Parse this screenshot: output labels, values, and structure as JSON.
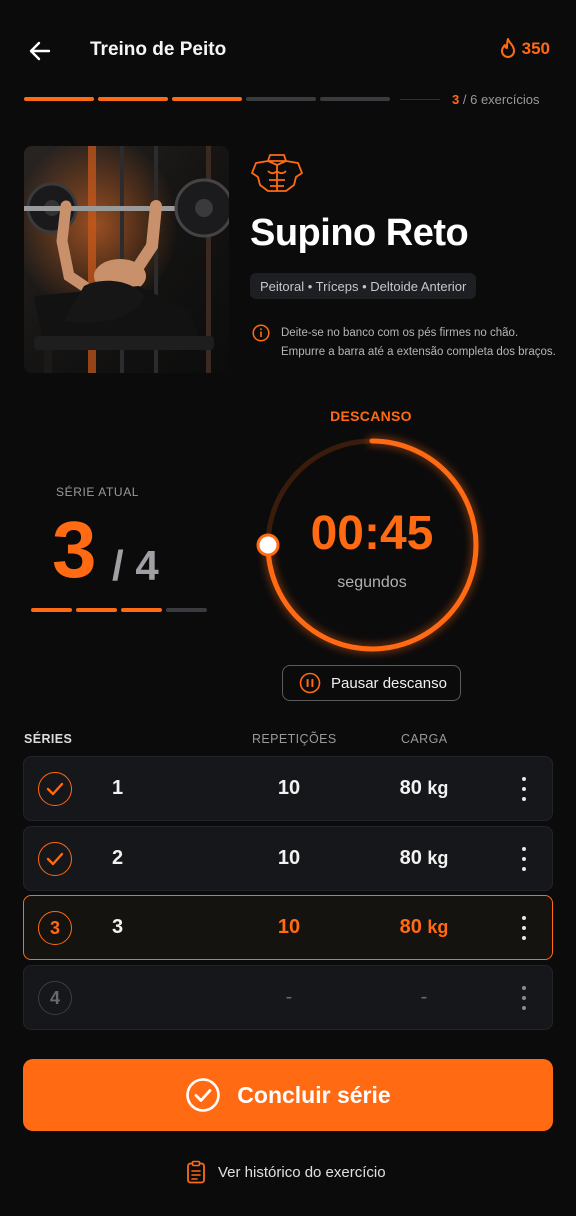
{
  "header": {
    "title": "Treino de Peito",
    "calories": "350"
  },
  "progress": {
    "current": "3",
    "separator": "/",
    "total_label": "6 exercícios",
    "completed_fraction": 0.5
  },
  "exercise": {
    "name": "Supino Reto",
    "muscles": "Peitoral • Tríceps • Deltoide Anterior",
    "instructions_line1": "Deite-se no banco com os pés firmes no chão.",
    "instructions_line2": "Empurre a barra até a extensão completa dos braços."
  },
  "current_set": {
    "label": "SÉRIE ATUAL",
    "number": "3",
    "total": "/ 4",
    "completed": 3,
    "of": 4
  },
  "rest_timer": {
    "label": "DESCANSO",
    "time": "00:45",
    "unit": "segundos",
    "remaining_fraction": 0.75,
    "pause_label": "Pausar descanso"
  },
  "sets_table": {
    "headers": {
      "series": "SÉRIES",
      "reps": "REPETIÇÕES",
      "load": "CARGA"
    },
    "rows": [
      {
        "index": "1",
        "reps": "10",
        "load": "80",
        "unit": "kg",
        "state": "done"
      },
      {
        "index": "2",
        "reps": "10",
        "load": "80",
        "unit": "kg",
        "state": "done"
      },
      {
        "index": "3",
        "status": "3",
        "reps": "10",
        "load": "80",
        "unit": "kg",
        "state": "current"
      },
      {
        "status": "4",
        "reps": "-",
        "load": "-",
        "state": "pending"
      }
    ]
  },
  "actions": {
    "complete_set": "Concluir série",
    "history": "Ver histórico do exercício"
  },
  "colors": {
    "accent": "#ff6a13",
    "background": "#0b0b0c",
    "card": "#16171a"
  }
}
